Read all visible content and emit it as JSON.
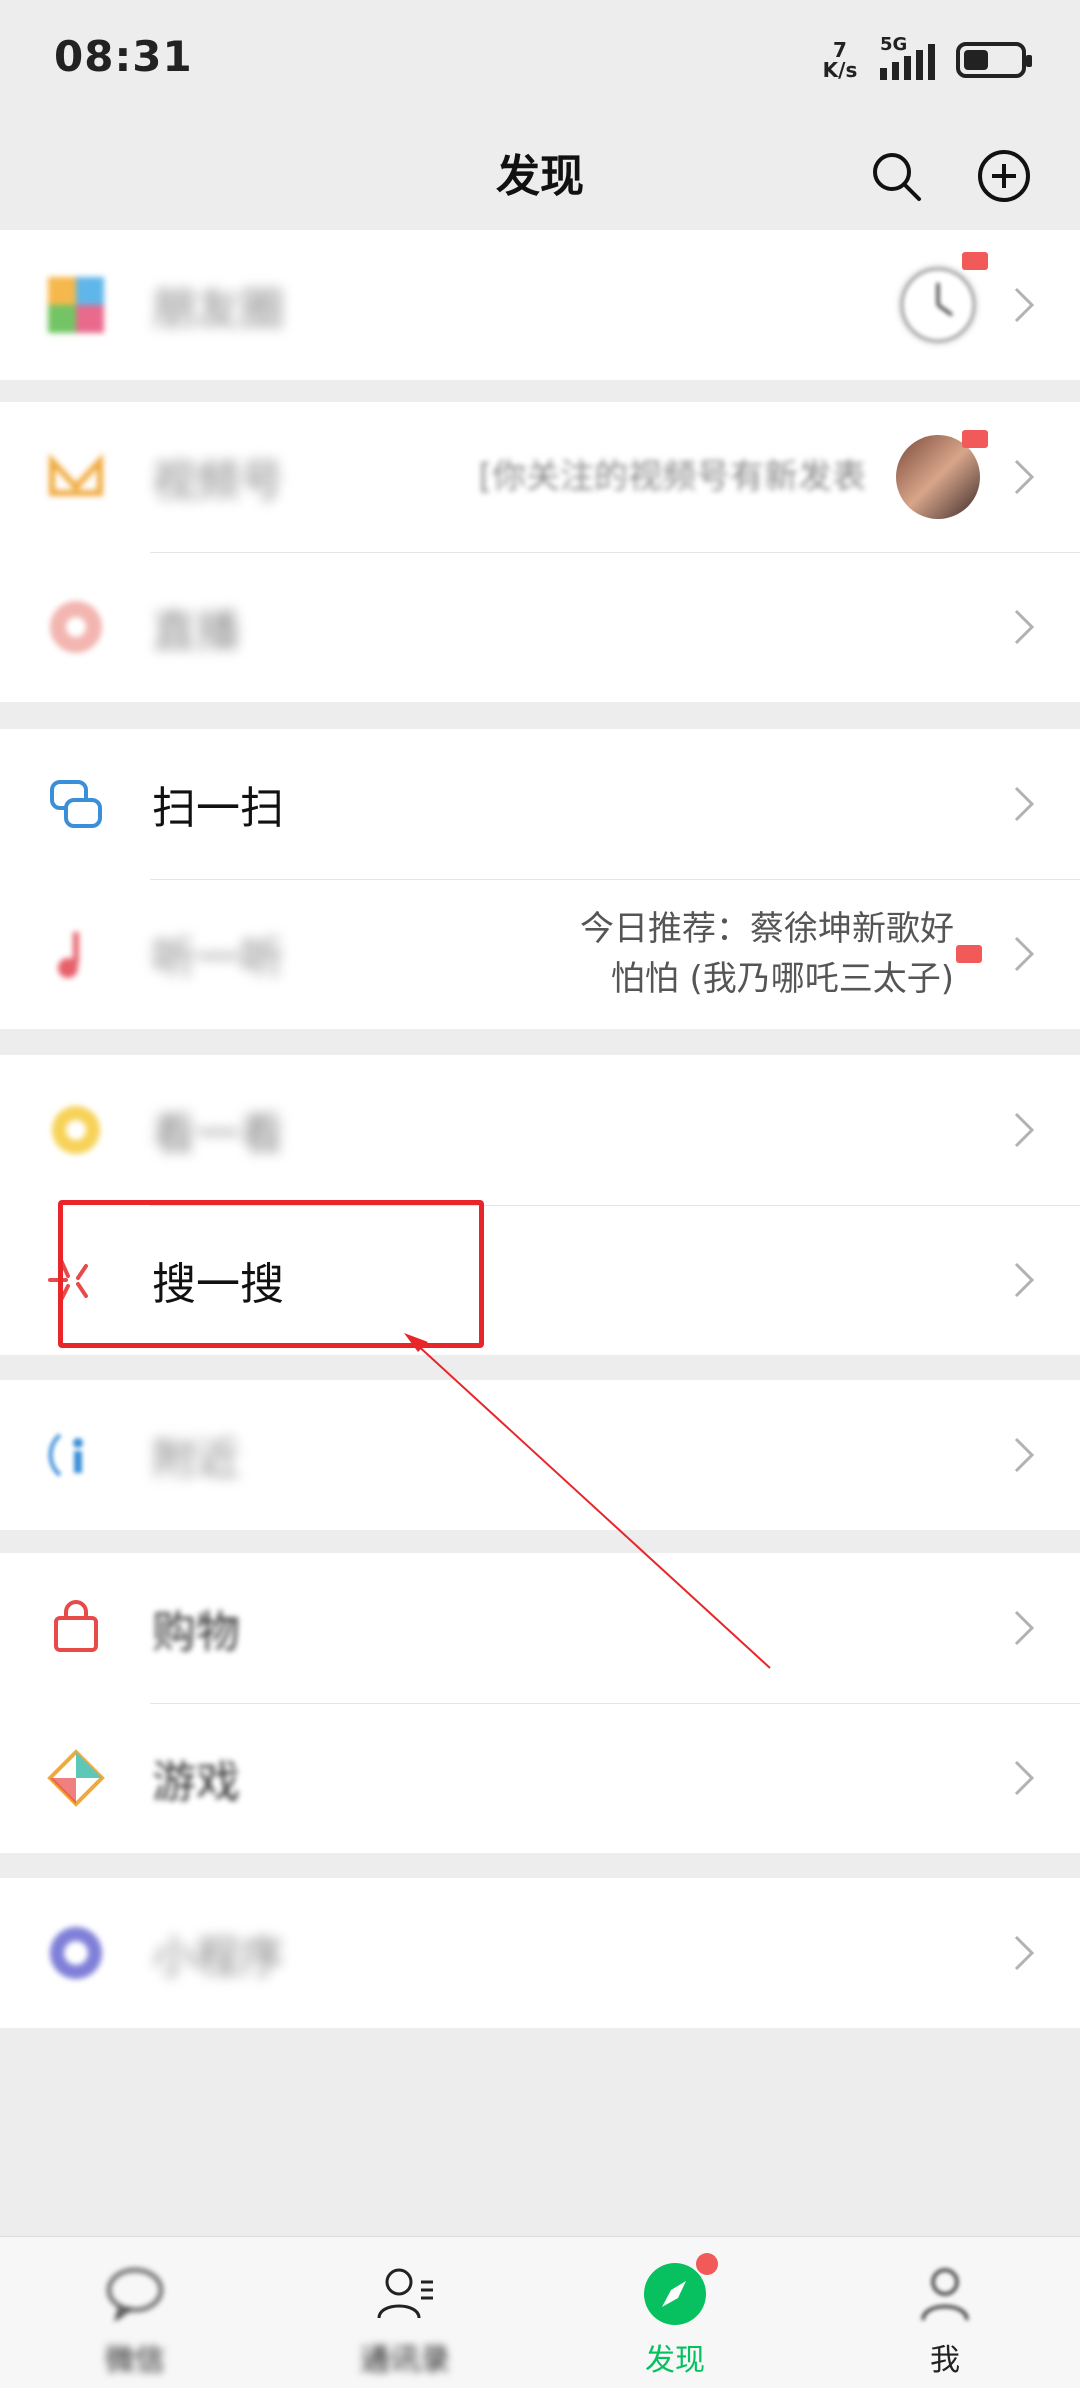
{
  "status": {
    "time": "08:31",
    "net_speed_value": "7",
    "net_speed_unit": "K/s",
    "network": "5G",
    "battery_level": 0.35
  },
  "header": {
    "title": "发现"
  },
  "groups": [
    {
      "items": [
        {
          "label": "朋友圈",
          "icon": "moments-icon"
        }
      ]
    },
    {
      "items": [
        {
          "label": "视频号",
          "icon": "channels-icon",
          "subtitle": "[你关注的视频号有新发表"
        },
        {
          "label": "直播",
          "icon": "live-icon"
        }
      ]
    },
    {
      "items": [
        {
          "label": "扫一扫",
          "icon": "scan-icon"
        },
        {
          "label": "听一听",
          "icon": "listen-icon",
          "subtitle_line1": "今日推荐：蔡徐坤新歌好",
          "subtitle_line2": "怕怕 (我乃哪吒三太子)"
        }
      ]
    },
    {
      "items": [
        {
          "label": "看一看",
          "icon": "top-stories-icon"
        },
        {
          "label": "搜一搜",
          "icon": "search-icon"
        }
      ]
    },
    {
      "items": [
        {
          "label": "附近",
          "icon": "nearby-icon"
        }
      ]
    },
    {
      "items": [
        {
          "label": "购物",
          "icon": "shopping-icon"
        },
        {
          "label": "游戏",
          "icon": "games-icon"
        }
      ]
    },
    {
      "items": [
        {
          "label": "小程序",
          "icon": "mini-programs-icon"
        }
      ]
    }
  ],
  "tabs": [
    {
      "label": "微信",
      "icon": "chats-icon"
    },
    {
      "label": "通讯录",
      "icon": "contacts-icon"
    },
    {
      "label": "发现",
      "icon": "discover-icon",
      "active": true
    },
    {
      "label": "我",
      "icon": "me-icon"
    }
  ],
  "colors": {
    "accent": "#07c160",
    "annotation": "#e8262a",
    "badge": "#f25a5a",
    "background": "#ededed"
  }
}
